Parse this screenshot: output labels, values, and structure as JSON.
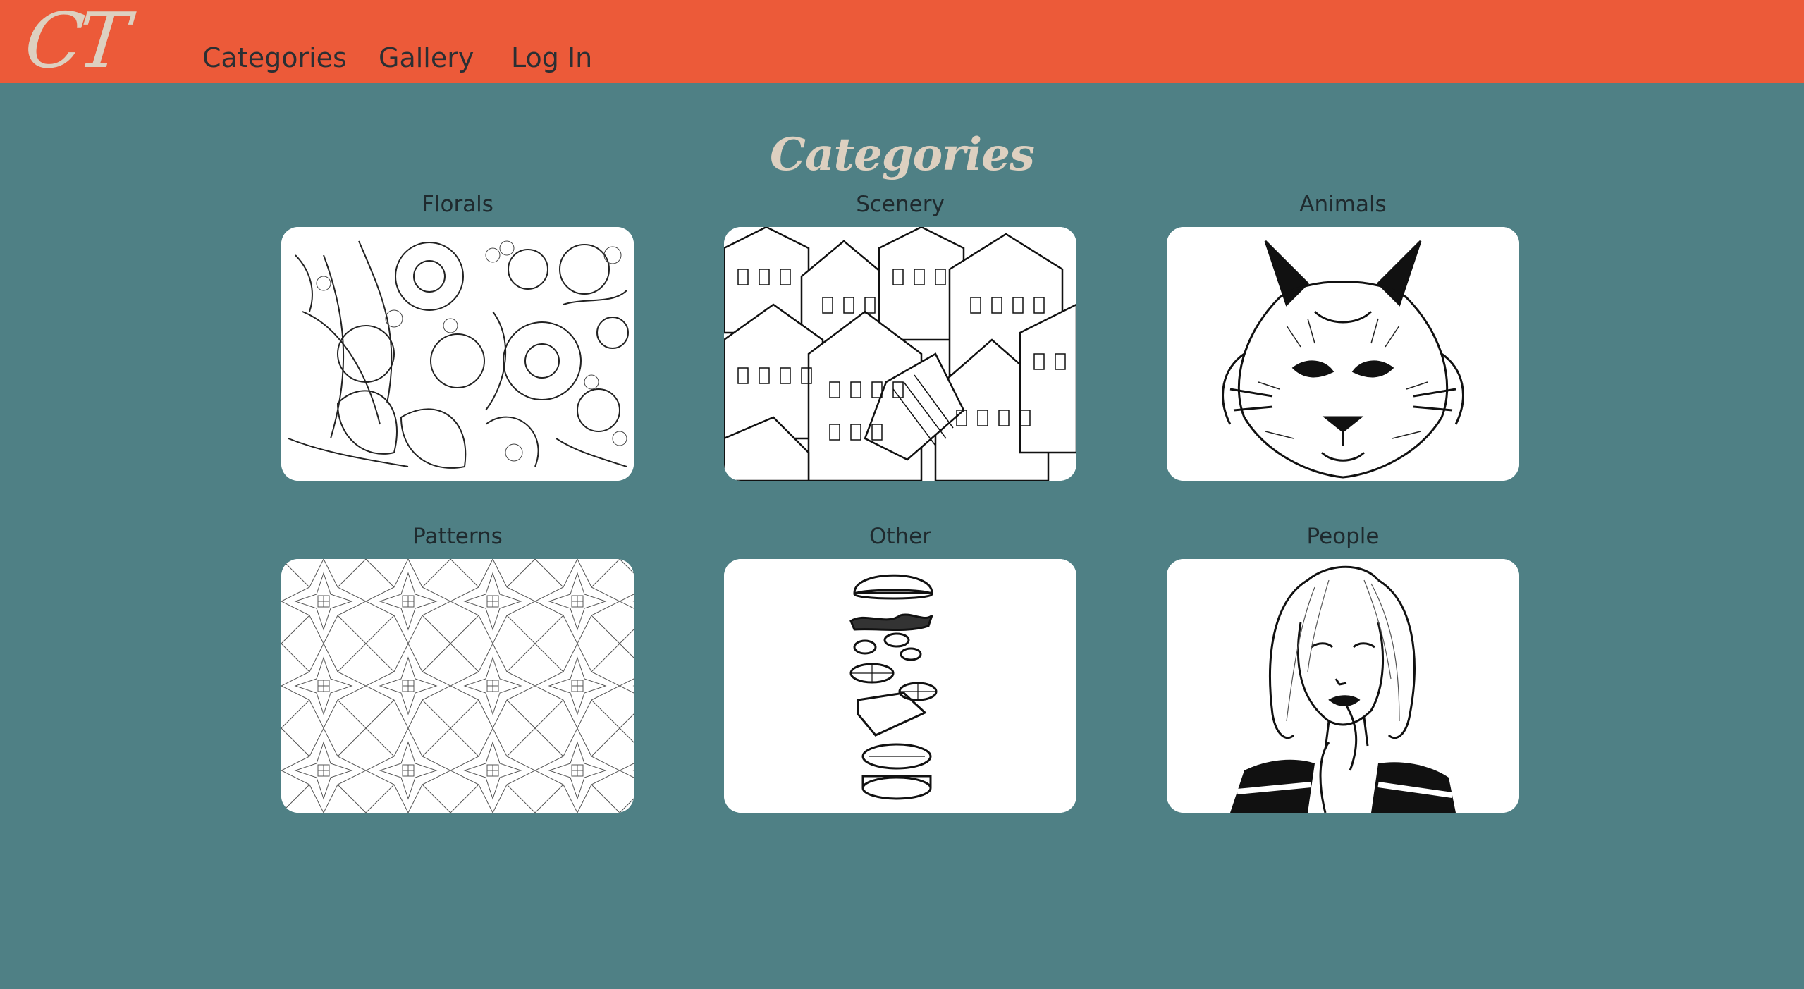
{
  "header": {
    "logo_text": "CT",
    "nav": [
      {
        "label": "Categories"
      },
      {
        "label": "Gallery"
      },
      {
        "label": "Log In"
      }
    ]
  },
  "main": {
    "title": "Categories",
    "categories": [
      {
        "label": "Florals",
        "image": "floral-line-drawing"
      },
      {
        "label": "Scenery",
        "image": "town-houses-line-drawing"
      },
      {
        "label": "Animals",
        "image": "lynx-head-line-drawing"
      },
      {
        "label": "Patterns",
        "image": "geometric-pattern-line-drawing"
      },
      {
        "label": "Other",
        "image": "exploded-burger-line-drawing"
      },
      {
        "label": "People",
        "image": "woman-portrait-line-drawing"
      }
    ]
  },
  "colors": {
    "header_bg": "#ec5a39",
    "page_bg": "#4f8085",
    "accent_text": "#ddd0c0",
    "card_bg": "#ffffff",
    "nav_text": "#2b2f33"
  }
}
